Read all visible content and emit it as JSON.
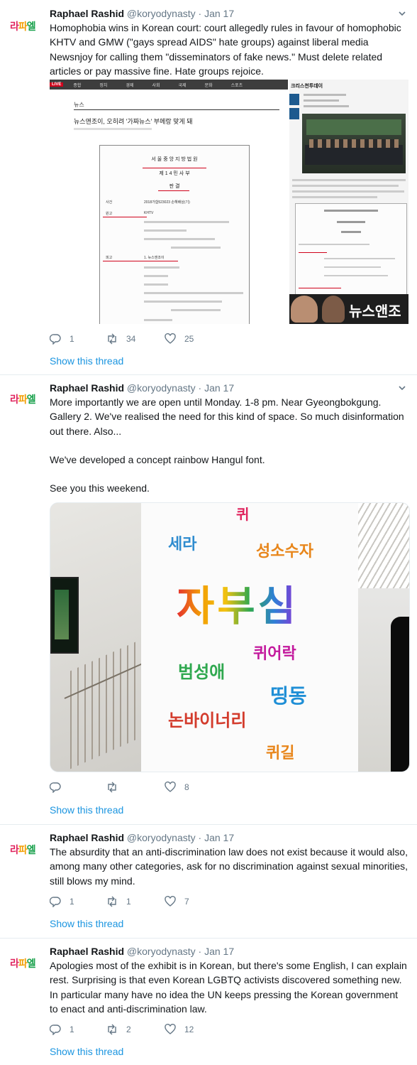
{
  "avatar": {
    "s1": "라",
    "s2": "파",
    "s3": "엘"
  },
  "tweets": [
    {
      "name": "Raphael Rashid",
      "handle": "@koryodynasty",
      "dot": "·",
      "date": "Jan 17",
      "text": "Homophobia wins in Korean court: court allegedly rules in favour of homophobic KHTV and GMW (\"gays spread AIDS\" hate groups) against liberal media Newsnjoy for calling them \"disseminators of fake news.\" Must delete related articles or pay massive fine. Hate groups rejoice.",
      "replies": "1",
      "retweets": "34",
      "likes": "25",
      "show_thread": "Show this thread",
      "media": {
        "nav": [
          "LIVE",
          "종합",
          "정치",
          "경제",
          "사회",
          "국제",
          "문화",
          "스포츠"
        ],
        "section": "뉴스",
        "headline": "뉴스앤조이, 오히려 '가짜뉴스' 부메랑 맞게 돼",
        "doc_court": "서 울 중 앙 지 방 법 원",
        "doc_dept": "제 1 4 민 사 부",
        "doc_type": "판 결",
        "doc_rows": [
          "사건",
          "2018가합523023 손해배상(기)",
          "원고",
          "KHTV",
          "피고",
          "1. 뉴스앤조이"
        ],
        "side_title": "크리스천투데이",
        "side_footer": "뉴스앤조"
      }
    },
    {
      "name": "Raphael Rashid",
      "handle": "@koryodynasty",
      "dot": "·",
      "date": "Jan 17",
      "p1": "More importantly we are open until Monday. 1-8 pm. Near Gyeongbokgung. Gallery 2. We've realised the need for this kind of space. So much disinformation out there. Also...",
      "p2": "We've developed a concept rainbow Hangul font.",
      "p3": "See you this weekend.",
      "replies": "",
      "retweets": "",
      "likes": "8",
      "show_thread": "Show this thread",
      "poster": {
        "w1": "퀴",
        "w2": "세라",
        "w3": "성소수자",
        "w4": "자부심",
        "w5": "퀴어락",
        "w6": "범성애",
        "w7": "띵동",
        "w8": "논바이너리",
        "w9": "퀴길"
      }
    },
    {
      "name": "Raphael Rashid",
      "handle": "@koryodynasty",
      "dot": "·",
      "date": "Jan 17",
      "text": "The absurdity that an anti-discrimination law does not exist because it would also, among many other categories, ask for no discrimination against sexual minorities, still blows my mind.",
      "replies": "1",
      "retweets": "1",
      "likes": "7",
      "show_thread": "Show this thread"
    },
    {
      "name": "Raphael Rashid",
      "handle": "@koryodynasty",
      "dot": "·",
      "date": "Jan 17",
      "text": "Apologies  most of the exhibit is in Korean, but there's some English, I can explain rest. Surprising is that even Korean LGBTQ activists discovered something new. In particular many have no idea the UN keeps pressing the Korean government to enact and anti-discrimination law.",
      "replies": "1",
      "retweets": "2",
      "likes": "12",
      "show_thread": "Show this thread"
    }
  ]
}
